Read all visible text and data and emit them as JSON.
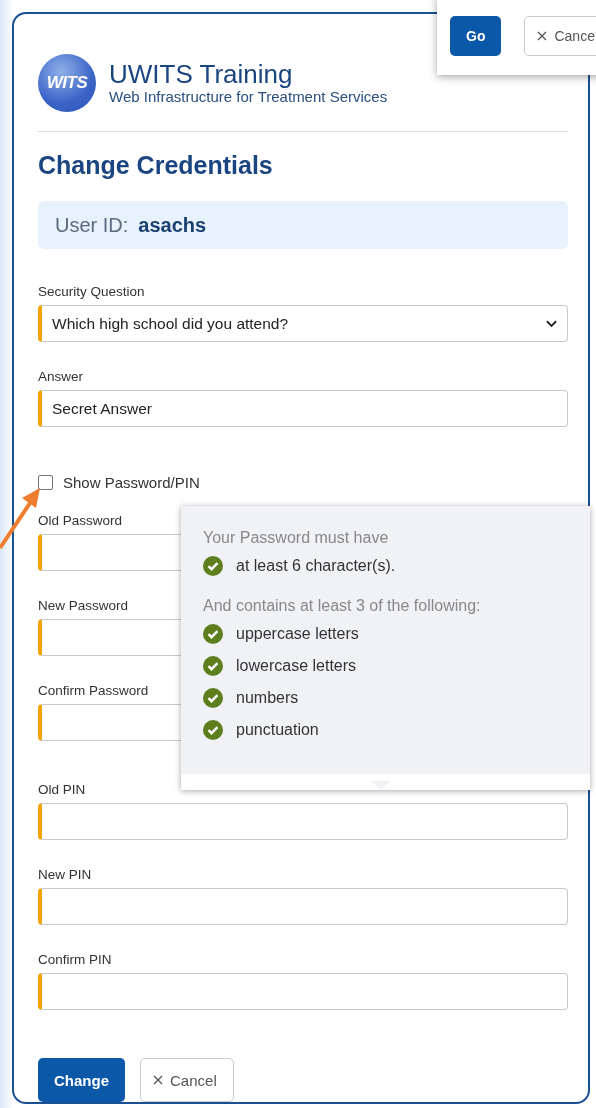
{
  "overlay": {
    "buttons": [
      {
        "label": "Go",
        "kind": "primary"
      },
      {
        "label": "Cance",
        "kind": "cancel"
      }
    ]
  },
  "app": {
    "logo_text": "WITS",
    "title": "UWITS Training",
    "subtitle": "Web Infrastructure for Treatment Services"
  },
  "page_title": "Change Credentials",
  "user_id": {
    "label": "User ID:",
    "value": "asachs"
  },
  "security_fields": [
    {
      "label": "Security Question",
      "kind": "select",
      "value": "Which high school did you attend?",
      "required": true
    },
    {
      "label": "Answer",
      "kind": "text",
      "value": "Secret Answer",
      "required": true
    }
  ],
  "show_password": {
    "label": "Show Password/PIN",
    "checked": false
  },
  "password_fields": [
    {
      "label": "Old Password",
      "kind": "password",
      "required": true
    },
    {
      "label": "New Password",
      "kind": "password",
      "required": true
    },
    {
      "label": "Confirm Password",
      "kind": "password",
      "required": true
    }
  ],
  "pin_fields": [
    {
      "label": "Old PIN",
      "kind": "password",
      "required": true
    },
    {
      "label": "New PIN",
      "kind": "password",
      "required": true
    },
    {
      "label": "Confirm PIN",
      "kind": "password",
      "required": true
    }
  ],
  "tooltip": {
    "heading": "Your Password must have",
    "rules": [
      {
        "text": "at least 6 character(s).",
        "met": true
      }
    ],
    "subheading": "And contains at least 3 of the following:",
    "options": [
      {
        "text": "uppercase letters",
        "met": true
      },
      {
        "text": "lowercase letters",
        "met": true
      },
      {
        "text": "numbers",
        "met": true
      },
      {
        "text": "punctuation",
        "met": true
      }
    ]
  },
  "buttons": [
    {
      "label": "Change",
      "kind": "primary"
    },
    {
      "label": "Cancel",
      "kind": "cancel"
    }
  ]
}
